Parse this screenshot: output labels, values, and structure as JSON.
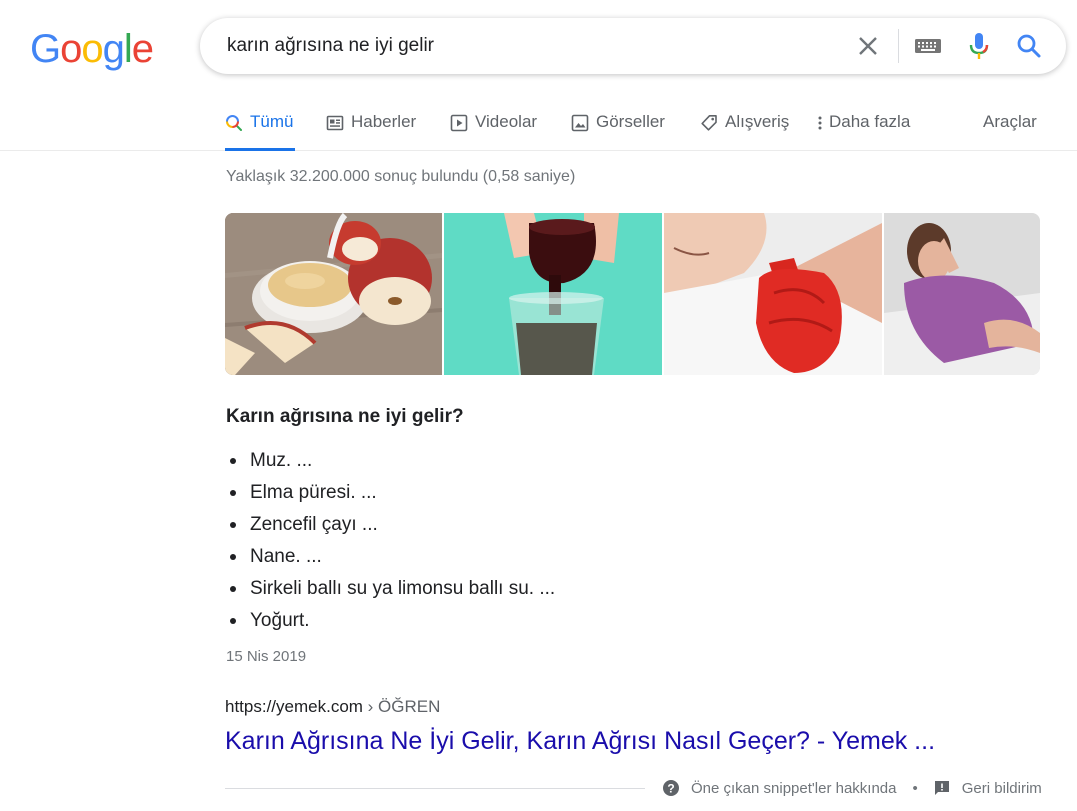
{
  "logo": {
    "letters": [
      "G",
      "o",
      "o",
      "g",
      "l",
      "e"
    ],
    "colors": [
      "#4285f4",
      "#ea4335",
      "#fbbc05",
      "#4285f4",
      "#34a853",
      "#ea4335"
    ]
  },
  "search": {
    "query": "karın ağrısına ne iyi gelir"
  },
  "tabs": [
    {
      "label": "Tümü",
      "icon": "search-icon"
    },
    {
      "label": "Haberler",
      "icon": "news-icon"
    },
    {
      "label": "Videolar",
      "icon": "video-icon"
    },
    {
      "label": "Görseller",
      "icon": "image-icon"
    },
    {
      "label": "Alışveriş",
      "icon": "tag-icon"
    },
    {
      "label": "Daha fazla",
      "icon": "more-vert-icon"
    }
  ],
  "tools_label": "Araçlar",
  "result_stats": "Yaklaşık 32.200.000 sonuç bulundu (0,58 saniye)",
  "images": [
    {
      "name": "applesauce-image"
    },
    {
      "name": "syrup-pour-image"
    },
    {
      "name": "hot-water-bottle-image"
    },
    {
      "name": "stomach-pain-woman-image"
    }
  ],
  "snippet": {
    "title": "Karın ağrısına ne iyi gelir?",
    "items": [
      "Muz. ...",
      "Elma püresi. ...",
      "Zencefil çayı ...",
      "Nane. ...",
      "Sirkeli ballı su ya limonsu ballı su. ...",
      "Yoğurt."
    ],
    "date": "15 Nis 2019"
  },
  "result": {
    "url": "https://yemek.com",
    "crumb": " › ÖĞREN",
    "title": "Karın Ağrısına Ne İyi Gelir, Karın Ağrısı Nasıl Geçer? - Yemek ..."
  },
  "footer": {
    "about": "Öne çıkan snippet'ler hakkında",
    "separator": "•",
    "feedback": "Geri bildirim"
  },
  "colors": {
    "accent": "#1a73e8",
    "link": "#1a0dab"
  }
}
